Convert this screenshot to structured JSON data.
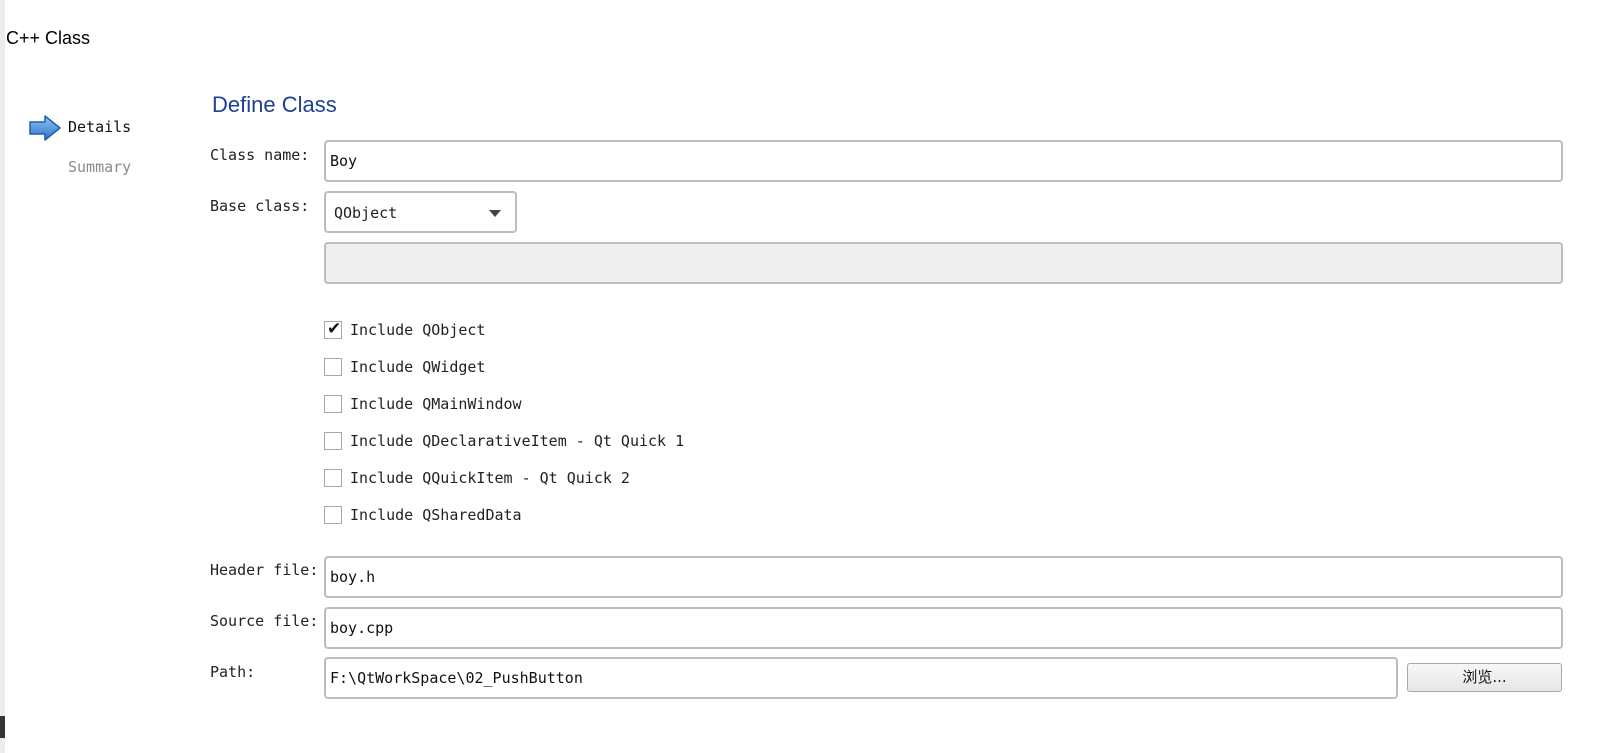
{
  "window": {
    "title": "C++ Class"
  },
  "steps": [
    {
      "label": "Details",
      "current": true
    },
    {
      "label": "Summary",
      "current": false
    }
  ],
  "page": {
    "heading": "Define Class"
  },
  "form": {
    "class_name_label": "Class name:",
    "class_name_value": "Boy",
    "base_class_label": "Base class:",
    "base_class_value": "QObject",
    "base_class_custom_value": "",
    "includes": [
      {
        "label": "Include QObject",
        "checked": true
      },
      {
        "label": "Include QWidget",
        "checked": false
      },
      {
        "label": "Include QMainWindow",
        "checked": false
      },
      {
        "label": "Include QDeclarativeItem - Qt Quick 1",
        "checked": false
      },
      {
        "label": "Include QQuickItem - Qt Quick 2",
        "checked": false
      },
      {
        "label": "Include QSharedData",
        "checked": false
      }
    ],
    "header_file_label": "Header file:",
    "header_file_value": "boy.h",
    "source_file_label": "Source file:",
    "source_file_value": "boy.cpp",
    "path_label": "Path:",
    "path_value": "F:\\QtWorkSpace\\02_PushButton",
    "browse_label": "浏览..."
  },
  "colors": {
    "heading": "#1d3f95",
    "step_inactive": "#8a8a8a",
    "arrow": "#3d8bd9"
  }
}
